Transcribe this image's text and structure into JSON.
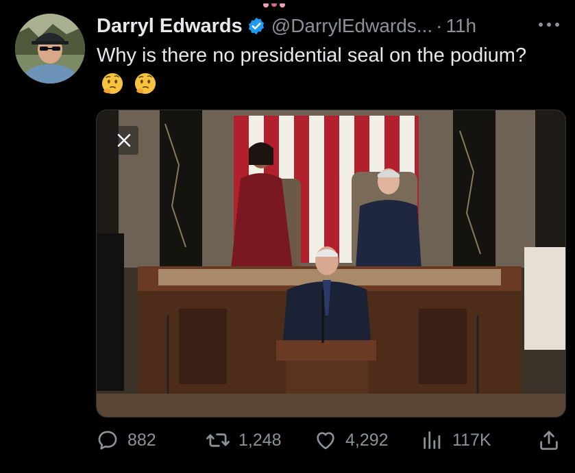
{
  "tweet": {
    "display_name": "Darryl Edwards",
    "handle": "@DarrylEdwards...",
    "separator": "·",
    "timestamp": "11h",
    "text_main": "Why is there no presidential seal on the podium?",
    "emojis": [
      "thinking-face",
      "thinking-face"
    ]
  },
  "icons": {
    "verified": "verified-badge-icon",
    "more": "more-options-icon",
    "close": "close-icon",
    "reply": "reply-icon",
    "retweet": "retweet-icon",
    "like": "heart-icon",
    "views": "views-chart-icon",
    "share": "share-icon"
  },
  "metrics": {
    "replies": "882",
    "retweets": "1,248",
    "likes": "4,292",
    "views": "117K"
  },
  "colors": {
    "background": "#000000",
    "text_primary": "#e7e9ea",
    "text_secondary": "#8b9298",
    "verified": "#1d9bf0"
  }
}
